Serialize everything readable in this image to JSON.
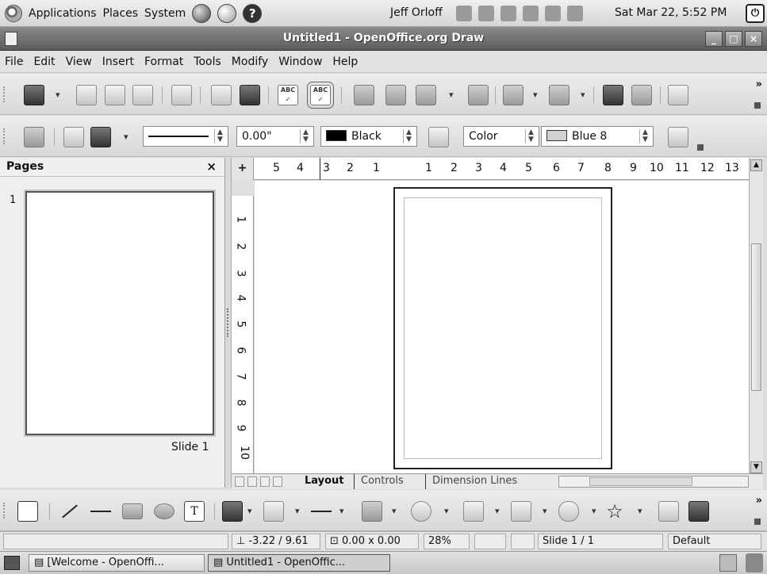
{
  "panel": {
    "menus": [
      "Applications",
      "Places",
      "System"
    ],
    "user": "Jeff Orloff",
    "clock": "Sat Mar 22,  5:52 PM"
  },
  "window": {
    "title": "Untitled1 - OpenOffice.org Draw"
  },
  "menubar": [
    "File",
    "Edit",
    "View",
    "Insert",
    "Format",
    "Tools",
    "Modify",
    "Window",
    "Help"
  ],
  "line_toolbar": {
    "width_value": "0.00\"",
    "line_color": "Black",
    "line_color_hex": "#000000",
    "area_style": "Color",
    "area_color": "Blue 8",
    "area_color_hex": "#d2d2d2"
  },
  "pages_panel": {
    "title": "Pages",
    "close": "×",
    "page_number": "1",
    "slide_label": "Slide 1"
  },
  "ruler": {
    "corner": "+",
    "h_ticks": [
      "5",
      "4",
      "3",
      "2",
      "1",
      "1",
      "2",
      "3",
      "4",
      "5",
      "6",
      "7",
      "8",
      "9",
      "10",
      "11",
      "12",
      "13"
    ],
    "v_ticks": [
      "1",
      "2",
      "3",
      "4",
      "5",
      "6",
      "7",
      "8",
      "9",
      "10"
    ]
  },
  "tabs": [
    "Layout",
    "Controls",
    "Dimension Lines"
  ],
  "status": {
    "position": "-3.22 / 9.61",
    "size": "0.00 x 0.00",
    "zoom": "28%",
    "slide": "Slide 1 / 1",
    "layout": "Default"
  },
  "taskbar": {
    "items": [
      "[Welcome - OpenOffi...",
      "Untitled1 - OpenOffic..."
    ]
  },
  "colors": {
    "accent": "#5c5c5c",
    "panel": "#dcdcdc"
  }
}
